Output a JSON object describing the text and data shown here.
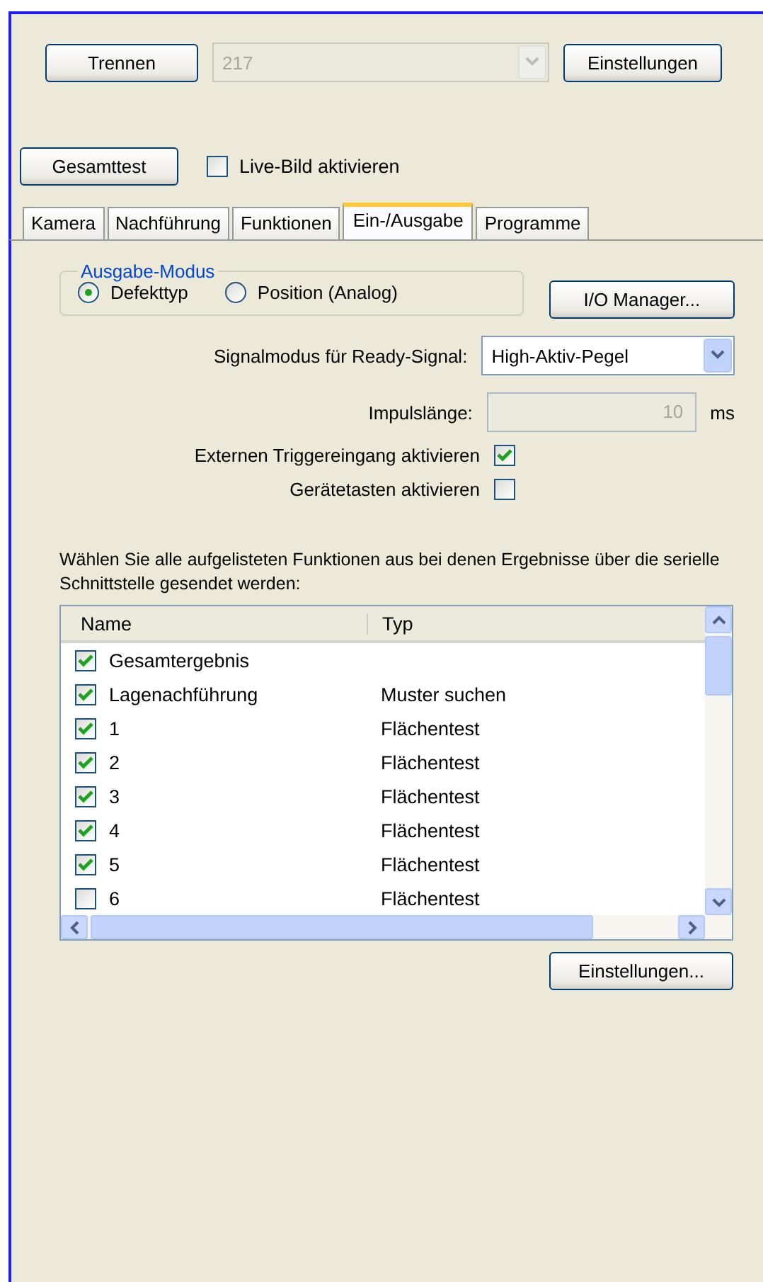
{
  "connection": {
    "disconnect_button": "Trennen",
    "device": {
      "value": "217",
      "disabled": true
    },
    "settings_button": "Einstellungen"
  },
  "test_bar": {
    "test_button": "Gesamttest",
    "live_image": {
      "label": "Live-Bild aktivieren",
      "checked": false
    }
  },
  "tabs": [
    {
      "label": "Kamera",
      "selected": false
    },
    {
      "label": "Nachführung",
      "selected": false
    },
    {
      "label": "Funktionen",
      "selected": false
    },
    {
      "label": "Ein-/Ausgabe",
      "selected": true
    },
    {
      "label": "Programme",
      "selected": false
    }
  ],
  "output_mode": {
    "title": "Ausgabe-Modus",
    "options": [
      {
        "label": "Defekttyp",
        "selected": true
      },
      {
        "label": "Position (Analog)",
        "selected": false
      }
    ]
  },
  "io_manager_button": "I/O Manager...",
  "signal_mode": {
    "label": "Signalmodus für Ready-Signal:",
    "value": "High-Aktiv-Pegel"
  },
  "pulse_length": {
    "label": "Impulslänge:",
    "value": "10",
    "unit": "ms",
    "disabled": true
  },
  "options": [
    {
      "label": "Externen Triggereingang aktivieren",
      "checked": true
    },
    {
      "label": "Gerätetasten aktivieren",
      "checked": false
    }
  ],
  "description": "Wählen Sie alle aufgelisteten Funktionen aus bei denen Ergebnisse über die serielle Schnittstelle gesendet werden:",
  "functions_table": {
    "columns": [
      "Name",
      "Typ"
    ],
    "rows": [
      {
        "name": "Gesamtergebnis",
        "checked": true
      },
      {
        "name": "Lagenachführung",
        "type": "Muster suchen",
        "checked": true
      },
      {
        "name": "1",
        "type": "Flächentest",
        "checked": true
      },
      {
        "name": "2",
        "type": "Flächentest",
        "checked": true
      },
      {
        "name": "3",
        "type": "Flächentest",
        "checked": true
      },
      {
        "name": "4",
        "type": "Flächentest",
        "checked": true
      },
      {
        "name": "5",
        "type": "Flächentest",
        "checked": true
      },
      {
        "name": "6",
        "type": "Flächentest",
        "checked": false
      }
    ]
  },
  "settings_dialog_button": "Einstellungen..."
}
